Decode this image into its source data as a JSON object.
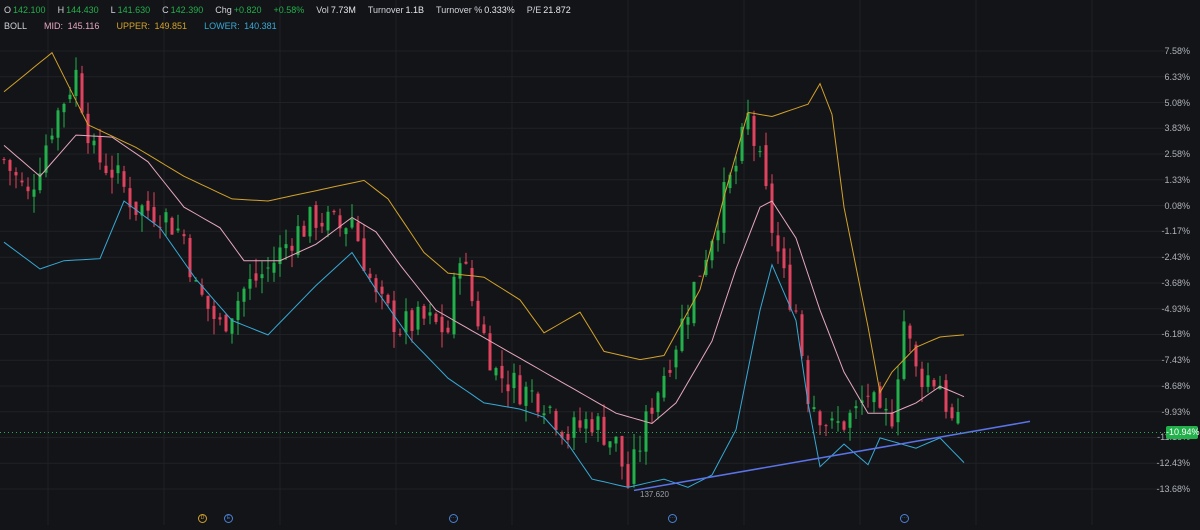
{
  "header": {
    "ohlc": [
      {
        "key": "O",
        "value": "142.100",
        "color": "#22b04b"
      },
      {
        "key": "H",
        "value": "144.430",
        "color": "#22b04b"
      },
      {
        "key": "L",
        "value": "141.630",
        "color": "#22b04b"
      },
      {
        "key": "C",
        "value": "142.390",
        "color": "#22b04b"
      },
      {
        "key": "Chg",
        "value": "+0.820",
        "color": "#22b04b"
      },
      {
        "key": "",
        "value": "+0.58%",
        "color": "#22b04b"
      },
      {
        "key": "Vol",
        "value": "7.73M",
        "color": "#e6e8eb"
      },
      {
        "key": "Turnover",
        "value": "1.1B",
        "color": "#e6e8eb"
      },
      {
        "key": "Turnover %",
        "value": "0.333%",
        "color": "#e6e8eb"
      },
      {
        "key": "P/E",
        "value": "21.872",
        "color": "#e6e8eb"
      }
    ],
    "boll": {
      "label": "BOLL",
      "mid_key": "MID:",
      "mid": "145.116",
      "mid_color": "#e6a8bf",
      "upper_key": "UPPER:",
      "upper": "149.851",
      "upper_color": "#d3a22a",
      "lower_key": "LOWER:",
      "lower": "140.381",
      "lower_color": "#37a9d6"
    }
  },
  "price_badge": "-10.94%",
  "low_label": "137.620",
  "markers": [
    {
      "glyph": "D",
      "color": "#d3a22a"
    },
    {
      "glyph": "E",
      "color": "#4a83d9"
    },
    {
      "glyph": "···",
      "color": "#4a83d9"
    },
    {
      "glyph": "···",
      "color": "#4a83d9"
    },
    {
      "glyph": "···",
      "color": "#4a83d9"
    }
  ],
  "chart_data": {
    "type": "line",
    "y_axis_labels": [
      "7.58%",
      "6.33%",
      "5.08%",
      "3.83%",
      "2.58%",
      "1.33%",
      "0.08%",
      "-1.17%",
      "-2.43%",
      "-3.68%",
      "-4.93%",
      "-6.18%",
      "-7.43%",
      "-8.68%",
      "-9.93%",
      "-11.18%",
      "-12.43%",
      "-13.68%"
    ],
    "y_axis_values": [
      7.58,
      6.33,
      5.08,
      3.83,
      2.58,
      1.33,
      0.08,
      -1.17,
      -2.43,
      -3.68,
      -4.93,
      -6.18,
      -7.43,
      -8.68,
      -9.93,
      -11.18,
      -12.43,
      -13.68
    ],
    "ylim": [
      -14.7,
      8.6
    ],
    "n_bars": 160,
    "last_value": -10.94,
    "series": [
      {
        "name": "UPPER",
        "color": "#d3a22a",
        "key_values": [
          [
            0,
            5.6
          ],
          [
            8,
            7.5
          ],
          [
            14,
            4.0
          ],
          [
            22,
            2.9
          ],
          [
            30,
            1.5
          ],
          [
            38,
            0.4
          ],
          [
            44,
            0.3
          ],
          [
            52,
            0.8
          ],
          [
            60,
            1.3
          ],
          [
            64,
            0.4
          ],
          [
            70,
            -2.2
          ],
          [
            74,
            -3.2
          ],
          [
            80,
            -3.4
          ],
          [
            86,
            -4.5
          ],
          [
            90,
            -6.1
          ],
          [
            96,
            -5.1
          ],
          [
            100,
            -7.0
          ],
          [
            106,
            -7.4
          ],
          [
            110,
            -7.2
          ],
          [
            116,
            -4.0
          ],
          [
            120,
            0.5
          ],
          [
            124,
            4.6
          ],
          [
            128,
            4.4
          ],
          [
            134,
            5.0
          ],
          [
            136,
            6.0
          ],
          [
            138,
            4.5
          ],
          [
            140,
            0.0
          ],
          [
            144,
            -5.8
          ],
          [
            146,
            -9.0
          ],
          [
            148,
            -8.0
          ],
          [
            152,
            -6.8
          ],
          [
            156,
            -6.3
          ],
          [
            160,
            -6.2
          ]
        ]
      },
      {
        "name": "MID",
        "color": "#e6a8bf",
        "key_values": [
          [
            0,
            3.0
          ],
          [
            6,
            1.5
          ],
          [
            12,
            3.5
          ],
          [
            18,
            3.4
          ],
          [
            24,
            2.2
          ],
          [
            30,
            0.0
          ],
          [
            36,
            -1.0
          ],
          [
            40,
            -2.6
          ],
          [
            46,
            -2.6
          ],
          [
            52,
            -1.8
          ],
          [
            58,
            -0.5
          ],
          [
            62,
            -1.2
          ],
          [
            66,
            -2.8
          ],
          [
            72,
            -5.0
          ],
          [
            78,
            -6.0
          ],
          [
            84,
            -7.0
          ],
          [
            90,
            -8.0
          ],
          [
            96,
            -9.0
          ],
          [
            102,
            -10.0
          ],
          [
            108,
            -10.5
          ],
          [
            112,
            -9.5
          ],
          [
            118,
            -6.5
          ],
          [
            122,
            -3.0
          ],
          [
            126,
            0.0
          ],
          [
            128,
            0.3
          ],
          [
            132,
            -1.5
          ],
          [
            136,
            -5.0
          ],
          [
            140,
            -8.0
          ],
          [
            144,
            -10.0
          ],
          [
            148,
            -10.0
          ],
          [
            152,
            -9.5
          ],
          [
            156,
            -8.7
          ],
          [
            160,
            -9.2
          ]
        ]
      },
      {
        "name": "LOWER",
        "color": "#37a9d6",
        "key_values": [
          [
            0,
            -1.7
          ],
          [
            6,
            -3.0
          ],
          [
            10,
            -2.6
          ],
          [
            16,
            -2.5
          ],
          [
            20,
            0.3
          ],
          [
            26,
            -1.0
          ],
          [
            32,
            -3.5
          ],
          [
            38,
            -5.5
          ],
          [
            44,
            -6.2
          ],
          [
            52,
            -3.8
          ],
          [
            58,
            -2.2
          ],
          [
            62,
            -4.0
          ],
          [
            68,
            -6.5
          ],
          [
            74,
            -8.3
          ],
          [
            80,
            -9.5
          ],
          [
            86,
            -9.8
          ],
          [
            90,
            -10.2
          ],
          [
            94,
            -11.5
          ],
          [
            98,
            -13.2
          ],
          [
            104,
            -13.6
          ],
          [
            110,
            -13.2
          ],
          [
            114,
            -13.6
          ],
          [
            118,
            -13.0
          ],
          [
            122,
            -10.8
          ],
          [
            126,
            -5.0
          ],
          [
            128,
            -2.8
          ],
          [
            132,
            -5.5
          ],
          [
            134,
            -9.5
          ],
          [
            136,
            -12.6
          ],
          [
            140,
            -11.5
          ],
          [
            144,
            -12.5
          ],
          [
            146,
            -11.2
          ],
          [
            152,
            -11.7
          ],
          [
            156,
            -11.2
          ],
          [
            160,
            -12.4
          ]
        ]
      }
    ],
    "trendline": {
      "color": "#5b73e8",
      "from": [
        105,
        -13.75
      ],
      "to": [
        171,
        -10.4
      ]
    },
    "candles_close_path": [
      [
        0,
        2.3
      ],
      [
        4,
        0.5
      ],
      [
        8,
        4.0
      ],
      [
        12,
        6.5
      ],
      [
        15,
        2.5
      ],
      [
        18,
        1.8
      ],
      [
        22,
        0.0
      ],
      [
        26,
        -0.2
      ],
      [
        30,
        -1.4
      ],
      [
        32,
        -4.0
      ],
      [
        36,
        -5.8
      ],
      [
        40,
        -4.0
      ],
      [
        44,
        -3.0
      ],
      [
        48,
        -1.4
      ],
      [
        52,
        -0.5
      ],
      [
        56,
        -1.0
      ],
      [
        58,
        -0.5
      ],
      [
        62,
        -4.5
      ],
      [
        66,
        -5.8
      ],
      [
        70,
        -5.5
      ],
      [
        74,
        -6.0
      ],
      [
        76,
        -2.0
      ],
      [
        78,
        -4.5
      ],
      [
        82,
        -8.0
      ],
      [
        86,
        -8.8
      ],
      [
        90,
        -9.3
      ],
      [
        94,
        -11.0
      ],
      [
        98,
        -10.3
      ],
      [
        102,
        -11.5
      ],
      [
        104,
        -13.5
      ],
      [
        108,
        -9.5
      ],
      [
        112,
        -6.5
      ],
      [
        116,
        -3.0
      ],
      [
        120,
        0.5
      ],
      [
        122,
        2.0
      ],
      [
        124,
        4.3
      ],
      [
        126,
        2.0
      ],
      [
        128,
        -1.0
      ],
      [
        130,
        -3.5
      ],
      [
        132,
        -5.0
      ],
      [
        134,
        -9.0
      ],
      [
        138,
        -10.8
      ],
      [
        142,
        -10.0
      ],
      [
        144,
        -9.0
      ],
      [
        146,
        -10.5
      ],
      [
        148,
        -10.0
      ],
      [
        150,
        -5.5
      ],
      [
        152,
        -8.0
      ],
      [
        156,
        -8.5
      ],
      [
        158,
        -10.5
      ],
      [
        160,
        -10.9
      ]
    ]
  }
}
